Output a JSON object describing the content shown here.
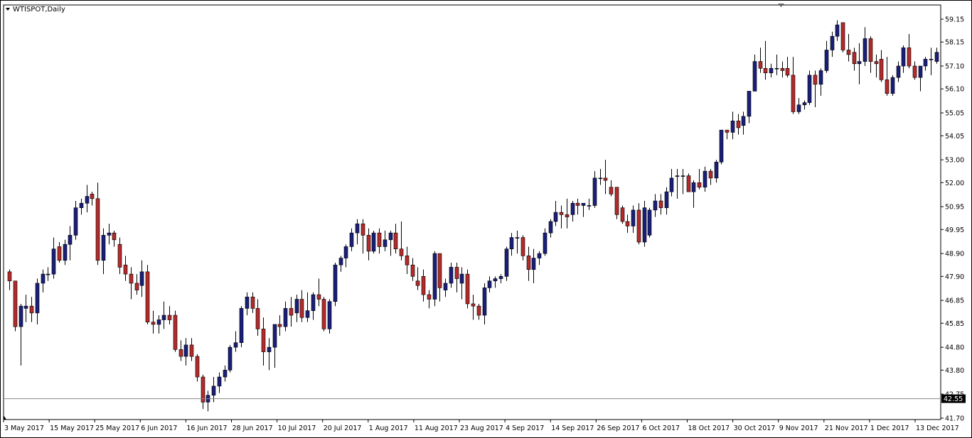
{
  "window_title": "WTISPOT,Daily",
  "current_price_label": "42.55",
  "colors": {
    "up": "#1a1f7a",
    "down": "#b52a2a",
    "wick": "#000000",
    "price_line": "#8a8a8a",
    "axis": "#000000"
  },
  "chart_data": {
    "type": "candlestick",
    "symbol": "WTISPOT",
    "timeframe": "Daily",
    "ylim": [
      41.7,
      59.6
    ],
    "yticks": [
      "59.15",
      "58.15",
      "57.10",
      "56.10",
      "55.05",
      "54.05",
      "53.00",
      "52.00",
      "50.95",
      "49.95",
      "48.90",
      "47.90",
      "46.85",
      "45.85",
      "44.80",
      "43.80",
      "42.75",
      "41.70"
    ],
    "xticks": [
      "3 May 2017",
      "15 May 2017",
      "25 May 2017",
      "6 Jun 2017",
      "16 Jun 2017",
      "28 Jun 2017",
      "10 Jul 2017",
      "20 Jul 2017",
      "1 Aug 2017",
      "11 Aug 2017",
      "23 Aug 2017",
      "4 Sep 2017",
      "14 Sep 2017",
      "26 Sep 2017",
      "6 Oct 2017",
      "18 Oct 2017",
      "30 Oct 2017",
      "9 Nov 2017",
      "21 Nov 2017",
      "1 Dec 2017",
      "13 Dec 2017"
    ],
    "current_price": 42.55,
    "candles": [
      [
        48.1,
        48.2,
        47.3,
        47.7
      ],
      [
        47.7,
        47.7,
        45.5,
        45.7
      ],
      [
        45.7,
        46.7,
        44.0,
        46.6
      ],
      [
        46.5,
        47.1,
        45.9,
        46.6
      ],
      [
        46.6,
        47.0,
        45.9,
        46.3
      ],
      [
        46.3,
        47.8,
        45.8,
        47.6
      ],
      [
        47.6,
        48.2,
        47.2,
        48.0
      ],
      [
        48.0,
        48.3,
        47.7,
        48.0
      ],
      [
        48.0,
        49.6,
        47.8,
        49.1
      ],
      [
        49.2,
        49.4,
        48.5,
        48.6
      ],
      [
        48.6,
        49.5,
        48.4,
        49.3
      ],
      [
        49.3,
        50.1,
        48.6,
        49.7
      ],
      [
        49.7,
        51.2,
        49.5,
        50.9
      ],
      [
        50.9,
        51.3,
        50.6,
        51.1
      ],
      [
        51.1,
        51.9,
        50.7,
        51.4
      ],
      [
        51.5,
        51.6,
        51.0,
        51.3
      ],
      [
        51.3,
        52.0,
        48.4,
        48.6
      ],
      [
        48.6,
        50.0,
        48.0,
        49.7
      ],
      [
        49.7,
        50.2,
        49.3,
        49.8
      ],
      [
        49.8,
        49.9,
        49.2,
        49.5
      ],
      [
        49.3,
        49.6,
        48.0,
        48.3
      ],
      [
        48.4,
        48.8,
        47.7,
        48.0
      ],
      [
        48.0,
        48.3,
        46.9,
        47.6
      ],
      [
        47.6,
        48.0,
        47.1,
        47.3
      ],
      [
        47.5,
        48.6,
        47.0,
        48.1
      ],
      [
        48.1,
        48.4,
        45.8,
        45.9
      ],
      [
        45.9,
        46.4,
        45.4,
        45.8
      ],
      [
        45.8,
        46.2,
        45.4,
        46.0
      ],
      [
        46.0,
        46.8,
        45.6,
        46.2
      ],
      [
        46.2,
        46.6,
        45.8,
        46.0
      ],
      [
        46.2,
        46.4,
        44.6,
        44.7
      ],
      [
        44.7,
        45.1,
        44.2,
        44.4
      ],
      [
        44.4,
        45.2,
        44.0,
        44.9
      ],
      [
        44.9,
        45.2,
        44.2,
        44.4
      ],
      [
        44.4,
        44.5,
        43.3,
        43.5
      ],
      [
        43.5,
        43.6,
        42.1,
        42.4
      ],
      [
        42.4,
        42.9,
        42.0,
        42.7
      ],
      [
        42.7,
        43.5,
        42.4,
        43.1
      ],
      [
        43.1,
        43.7,
        42.8,
        43.5
      ],
      [
        43.5,
        44.0,
        43.3,
        43.8
      ],
      [
        43.8,
        44.9,
        43.7,
        44.8
      ],
      [
        44.8,
        45.5,
        44.6,
        45.0
      ],
      [
        45.0,
        46.6,
        44.8,
        46.5
      ],
      [
        46.5,
        47.2,
        46.2,
        47.0
      ],
      [
        47.0,
        47.2,
        46.3,
        46.5
      ],
      [
        46.5,
        46.9,
        45.3,
        45.6
      ],
      [
        45.6,
        46.1,
        44.0,
        44.6
      ],
      [
        44.6,
        45.2,
        43.8,
        44.8
      ],
      [
        44.8,
        45.8,
        43.9,
        45.8
      ],
      [
        45.8,
        46.2,
        45.3,
        45.7
      ],
      [
        45.7,
        46.8,
        45.5,
        46.5
      ],
      [
        46.5,
        47.0,
        45.7,
        46.2
      ],
      [
        46.3,
        47.1,
        45.9,
        46.9
      ],
      [
        46.9,
        47.3,
        45.9,
        46.1
      ],
      [
        46.1,
        47.2,
        45.9,
        46.4
      ],
      [
        46.4,
        47.2,
        46.0,
        47.1
      ],
      [
        47.1,
        47.8,
        46.6,
        46.9
      ],
      [
        46.9,
        47.0,
        45.5,
        45.6
      ],
      [
        45.6,
        46.9,
        45.4,
        46.8
      ],
      [
        46.8,
        48.5,
        46.6,
        48.4
      ],
      [
        48.4,
        48.8,
        48.1,
        48.7
      ],
      [
        48.7,
        49.3,
        48.3,
        49.2
      ],
      [
        49.2,
        50.0,
        49.0,
        49.8
      ],
      [
        49.8,
        50.4,
        49.3,
        50.2
      ],
      [
        50.2,
        50.4,
        48.9,
        49.7
      ],
      [
        49.7,
        50.0,
        48.6,
        49.0
      ],
      [
        49.0,
        49.9,
        48.9,
        49.8
      ],
      [
        49.8,
        50.0,
        48.9,
        49.2
      ],
      [
        49.2,
        49.9,
        49.0,
        49.5
      ],
      [
        49.5,
        49.9,
        48.8,
        49.8
      ],
      [
        49.8,
        50.2,
        48.9,
        49.1
      ],
      [
        49.1,
        50.3,
        48.6,
        48.8
      ],
      [
        48.8,
        49.2,
        48.0,
        48.4
      ],
      [
        48.4,
        48.7,
        47.7,
        47.9
      ],
      [
        47.7,
        48.3,
        47.3,
        47.5
      ],
      [
        47.9,
        48.2,
        46.8,
        47.1
      ],
      [
        47.1,
        47.3,
        46.5,
        46.9
      ],
      [
        46.9,
        49.0,
        46.6,
        48.9
      ],
      [
        48.9,
        48.9,
        46.8,
        47.4
      ],
      [
        47.3,
        47.8,
        47.0,
        47.6
      ],
      [
        47.6,
        48.5,
        47.4,
        48.3
      ],
      [
        48.3,
        48.5,
        47.2,
        47.8
      ],
      [
        47.6,
        48.3,
        46.9,
        48.0
      ],
      [
        48.0,
        48.2,
        46.5,
        46.7
      ],
      [
        46.7,
        47.1,
        46.0,
        46.6
      ],
      [
        46.6,
        46.7,
        46.0,
        46.2
      ],
      [
        46.2,
        47.6,
        45.8,
        47.4
      ],
      [
        47.4,
        47.9,
        47.2,
        47.7
      ],
      [
        47.7,
        47.9,
        47.4,
        47.8
      ],
      [
        47.8,
        48.0,
        47.6,
        47.9
      ],
      [
        47.9,
        49.2,
        47.7,
        49.1
      ],
      [
        49.1,
        49.8,
        48.8,
        49.6
      ],
      [
        49.6,
        49.9,
        48.9,
        49.6
      ],
      [
        49.6,
        49.7,
        48.6,
        48.8
      ],
      [
        48.8,
        49.2,
        47.7,
        48.2
      ],
      [
        48.2,
        49.1,
        47.6,
        48.7
      ],
      [
        48.7,
        49.0,
        48.4,
        48.9
      ],
      [
        48.9,
        50.0,
        48.8,
        49.8
      ],
      [
        49.8,
        50.4,
        49.6,
        50.3
      ],
      [
        50.3,
        51.2,
        50.1,
        50.7
      ],
      [
        50.7,
        51.0,
        50.0,
        50.6
      ],
      [
        50.6,
        51.3,
        50.0,
        50.5
      ],
      [
        50.6,
        51.2,
        50.3,
        51.1
      ],
      [
        51.1,
        51.3,
        50.6,
        51.0
      ],
      [
        51.0,
        51.1,
        50.5,
        51.1
      ],
      [
        51.0,
        51.3,
        50.8,
        51.0
      ],
      [
        51.0,
        52.5,
        50.9,
        52.2
      ],
      [
        52.2,
        52.6,
        51.9,
        52.2
      ],
      [
        52.2,
        53.0,
        51.5,
        52.1
      ],
      [
        51.8,
        52.1,
        51.4,
        51.5
      ],
      [
        51.8,
        51.8,
        50.4,
        50.6
      ],
      [
        50.9,
        51.0,
        50.2,
        50.3
      ],
      [
        50.3,
        50.6,
        49.8,
        50.1
      ],
      [
        50.1,
        51.0,
        49.8,
        50.8
      ],
      [
        50.8,
        51.1,
        49.3,
        49.4
      ],
      [
        49.4,
        51.2,
        49.2,
        50.9
      ],
      [
        49.7,
        50.9,
        49.6,
        50.8
      ],
      [
        50.8,
        51.5,
        50.5,
        51.2
      ],
      [
        51.2,
        51.5,
        50.6,
        50.9
      ],
      [
        50.9,
        51.8,
        50.6,
        51.6
      ],
      [
        51.6,
        52.6,
        51.4,
        52.2
      ],
      [
        52.3,
        52.6,
        51.3,
        52.3
      ],
      [
        52.3,
        52.6,
        51.5,
        52.3
      ],
      [
        52.3,
        52.4,
        51.6,
        51.6
      ],
      [
        51.6,
        52.1,
        50.9,
        52.0
      ],
      [
        52.0,
        52.6,
        51.7,
        51.8
      ],
      [
        51.8,
        52.7,
        51.6,
        52.5
      ],
      [
        52.5,
        52.6,
        51.9,
        52.2
      ],
      [
        52.2,
        53.0,
        52.0,
        52.9
      ],
      [
        52.9,
        54.2,
        52.8,
        54.3
      ],
      [
        54.3,
        54.3,
        53.9,
        54.2
      ],
      [
        54.2,
        55.1,
        53.9,
        54.7
      ],
      [
        54.7,
        55.0,
        54.1,
        54.4
      ],
      [
        54.5,
        55.1,
        54.1,
        54.9
      ],
      [
        54.9,
        56.0,
        54.6,
        56.0
      ],
      [
        56.0,
        57.6,
        56.0,
        57.3
      ],
      [
        57.3,
        57.9,
        56.8,
        57.0
      ],
      [
        57.0,
        58.2,
        56.5,
        56.8
      ],
      [
        56.8,
        57.2,
        56.6,
        57.0
      ],
      [
        57.0,
        57.6,
        56.7,
        57.0
      ],
      [
        57.0,
        57.3,
        56.6,
        56.9
      ],
      [
        57.0,
        57.5,
        56.6,
        56.7
      ],
      [
        56.7,
        57.5,
        55.0,
        55.1
      ],
      [
        55.1,
        55.7,
        55.0,
        55.4
      ],
      [
        55.4,
        55.6,
        55.2,
        55.5
      ],
      [
        55.5,
        56.9,
        55.4,
        56.7
      ],
      [
        56.7,
        56.9,
        55.3,
        56.3
      ],
      [
        56.3,
        57.0,
        55.8,
        56.9
      ],
      [
        56.9,
        58.2,
        56.8,
        57.8
      ],
      [
        57.8,
        58.6,
        57.5,
        58.4
      ],
      [
        58.4,
        59.1,
        58.2,
        58.9
      ],
      [
        59.0,
        59.0,
        57.7,
        57.8
      ],
      [
        57.8,
        58.5,
        57.3,
        57.6
      ],
      [
        57.7,
        57.9,
        56.9,
        57.2
      ],
      [
        57.2,
        58.1,
        56.3,
        57.3
      ],
      [
        57.3,
        58.8,
        57.1,
        58.3
      ],
      [
        58.3,
        58.4,
        56.8,
        57.3
      ],
      [
        57.3,
        57.6,
        56.6,
        57.2
      ],
      [
        57.4,
        57.8,
        56.4,
        56.5
      ],
      [
        56.5,
        57.5,
        55.8,
        55.9
      ],
      [
        55.9,
        56.7,
        55.8,
        56.6
      ],
      [
        56.6,
        57.3,
        56.4,
        57.1
      ],
      [
        57.1,
        58.0,
        56.8,
        57.9
      ],
      [
        57.9,
        58.5,
        57.0,
        57.1
      ],
      [
        57.1,
        57.3,
        56.5,
        56.6
      ],
      [
        56.6,
        57.0,
        56.0,
        57.1
      ],
      [
        57.1,
        57.5,
        56.9,
        57.4
      ],
      [
        57.4,
        57.9,
        56.7,
        57.4
      ],
      [
        57.3,
        57.9,
        57.2,
        57.7
      ]
    ]
  }
}
